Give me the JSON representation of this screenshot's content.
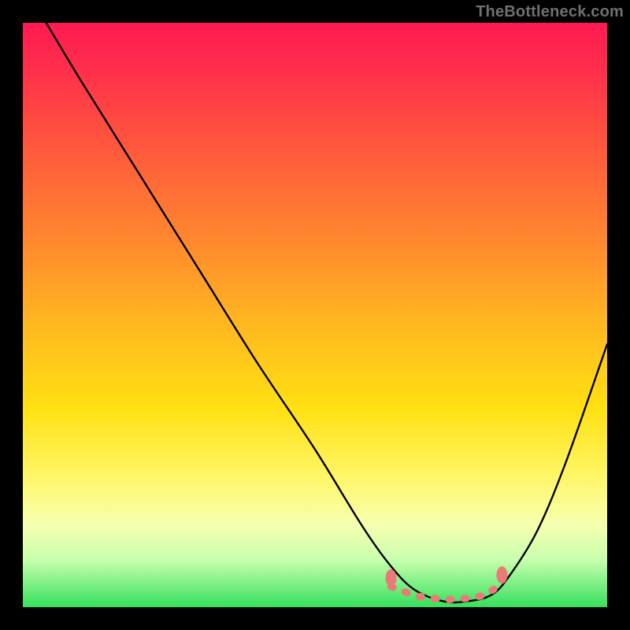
{
  "watermark": "TheBottleneck.com",
  "chart_data": {
    "type": "line",
    "title": "",
    "xlabel": "",
    "ylabel": "",
    "xlim": [
      0,
      100
    ],
    "ylim": [
      0,
      100
    ],
    "series": [
      {
        "name": "curve",
        "x": [
          4,
          10,
          20,
          30,
          40,
          50,
          58,
          63,
          67,
          72,
          76,
          80,
          83,
          88,
          93,
          100
        ],
        "y": [
          100,
          90,
          74,
          58,
          42,
          27,
          14,
          7,
          3,
          1,
          1,
          2,
          5,
          13,
          25,
          45
        ]
      }
    ],
    "markers": {
      "name": "highlight-band",
      "color": "#e97a78",
      "points_x": [
        63,
        67,
        70,
        73,
        76,
        79,
        82
      ],
      "points_y": [
        3.5,
        2,
        1.5,
        1.3,
        1.5,
        2,
        4
      ]
    },
    "gradient_stops": [
      {
        "pos": 0,
        "color": "#ff1a52"
      },
      {
        "pos": 8,
        "color": "#ff2f4a"
      },
      {
        "pos": 22,
        "color": "#ff5a3c"
      },
      {
        "pos": 38,
        "color": "#ff8a2e"
      },
      {
        "pos": 52,
        "color": "#ffb91f"
      },
      {
        "pos": 66,
        "color": "#ffe012"
      },
      {
        "pos": 78,
        "color": "#fff76a"
      },
      {
        "pos": 86,
        "color": "#f6ffb0"
      },
      {
        "pos": 92,
        "color": "#c6ffad"
      },
      {
        "pos": 100,
        "color": "#34e05b"
      }
    ]
  }
}
